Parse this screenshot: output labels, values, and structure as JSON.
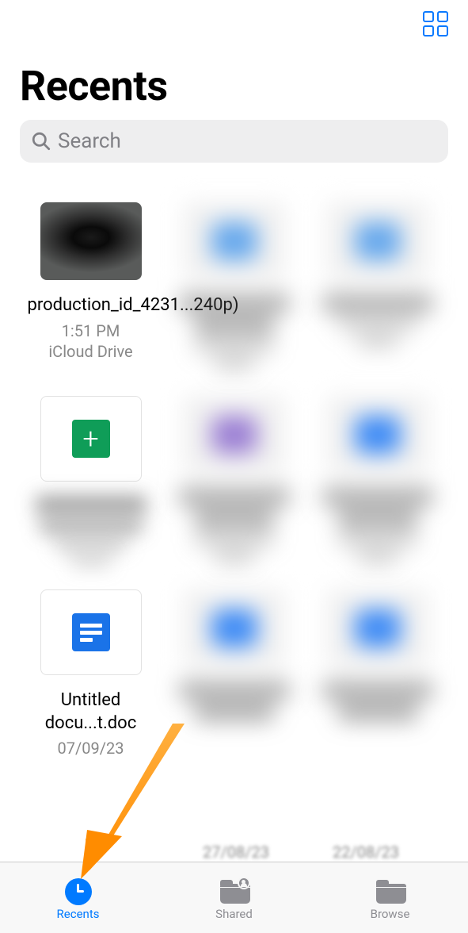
{
  "header": {
    "title": "Recents"
  },
  "search": {
    "placeholder": "Search"
  },
  "files": [
    {
      "name": "production_id_4231...240p)",
      "time": "1:51 PM",
      "location": "iCloud Drive"
    },
    {
      "name": "Untitled docu...t.doc",
      "date": "07/09/23"
    }
  ],
  "partial_dates": {
    "col2": "27/08/23",
    "col3": "22/08/23"
  },
  "tabs": {
    "recents": "Recents",
    "shared": "Shared",
    "browse": "Browse"
  },
  "accent_color": "#007aff",
  "arrow_color": "#ff9500"
}
